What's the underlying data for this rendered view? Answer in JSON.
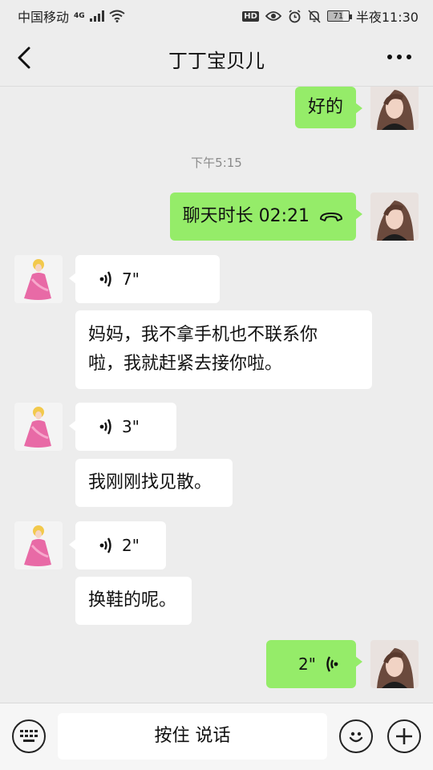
{
  "status_bar": {
    "carrier": "中国移动",
    "network": "4G",
    "battery": "71",
    "time": "半夜11:30",
    "hd_badge": "HD"
  },
  "header": {
    "title": "丁丁宝贝儿",
    "back_icon": "chevron-left-icon",
    "more_icon": "more-dots-icon"
  },
  "messages": {
    "m1": {
      "text": "好的"
    },
    "timestamp": "下午5:15",
    "call": {
      "text": "聊天时长 02:21",
      "icon": "phone-hangup-icon"
    },
    "v1": {
      "duration": "7\""
    },
    "t1": {
      "line1": "妈妈，我不拿手机也不联系你",
      "line2": "啦，我就赶紧去接你啦。"
    },
    "v2": {
      "duration": "3\""
    },
    "t2": {
      "text": "我刚刚找见散。"
    },
    "v3": {
      "duration": "2\""
    },
    "t3": {
      "text": "换鞋的呢。"
    },
    "v4": {
      "duration": "2\""
    }
  },
  "bottom_bar": {
    "hold_to_talk": "按住 说话",
    "keyboard_icon": "keyboard-icon",
    "emoji_icon": "emoji-icon",
    "plus_icon": "plus-icon"
  },
  "colors": {
    "background": "#ededed",
    "my_bubble": "#95ec69",
    "other_bubble": "#ffffff"
  }
}
